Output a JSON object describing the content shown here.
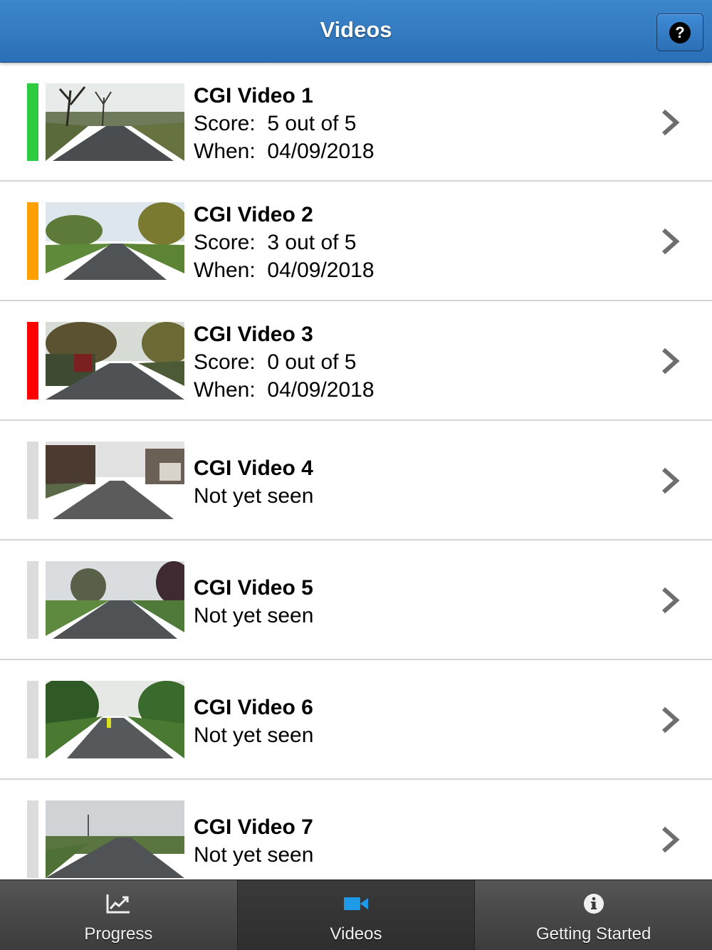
{
  "header": {
    "title": "Videos",
    "help_icon": "question-circle-icon",
    "help_symbol": "?"
  },
  "colors": {
    "header": "#2f77bd",
    "good": "#2ecc40",
    "medium": "#ff9f00",
    "bad": "#ff0000",
    "unseen": "#dcdcdc",
    "active_tab_icon": "#1e9be8"
  },
  "videos": [
    {
      "title": "CGI Video 1",
      "status": "good",
      "score_label": "Score:",
      "score": "5 out of 5",
      "when_label": "When:",
      "when": "04/09/2018"
    },
    {
      "title": "CGI Video 2",
      "status": "medium",
      "score_label": "Score:",
      "score": "3 out of 5",
      "when_label": "When:",
      "when": "04/09/2018"
    },
    {
      "title": "CGI Video 3",
      "status": "bad",
      "score_label": "Score:",
      "score": "0 out of 5",
      "when_label": "When:",
      "when": "04/09/2018"
    },
    {
      "title": "CGI Video 4",
      "status": "unseen",
      "note": "Not yet seen"
    },
    {
      "title": "CGI Video 5",
      "status": "unseen",
      "note": "Not yet seen"
    },
    {
      "title": "CGI Video 6",
      "status": "unseen",
      "note": "Not yet seen"
    },
    {
      "title": "CGI Video 7",
      "status": "unseen",
      "note": "Not yet seen"
    }
  ],
  "tabs": [
    {
      "label": "Progress",
      "icon": "line-chart-icon"
    },
    {
      "label": "Videos",
      "icon": "video-camera-icon",
      "active": true
    },
    {
      "label": "Getting Started",
      "icon": "info-circle-icon"
    }
  ]
}
